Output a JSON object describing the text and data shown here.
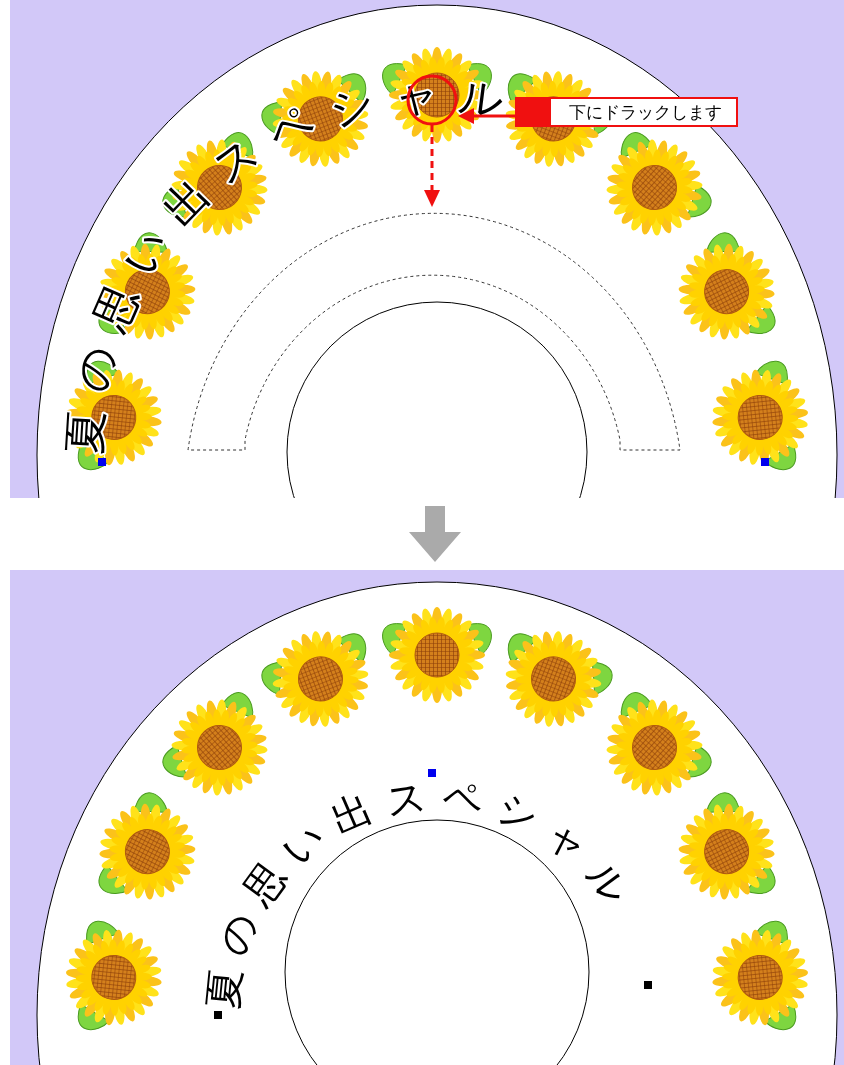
{
  "top_panel": {
    "curved_text": "夏の思い出スペシャル",
    "callout": "下にドラックします"
  },
  "bottom_panel": {
    "curved_text": "夏の思い出スペシャル"
  }
}
